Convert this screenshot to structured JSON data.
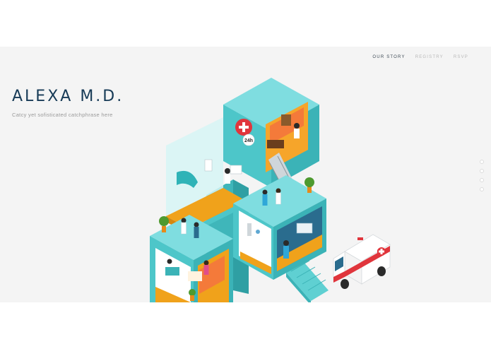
{
  "nav": {
    "items": [
      {
        "label": "OUR STORY",
        "active": true
      },
      {
        "label": "REGISTRY",
        "active": false
      },
      {
        "label": "RSVP",
        "active": false
      }
    ]
  },
  "hero": {
    "title": "ALEXA M.D.",
    "tagline": "Catcy yet sofisticated catchphrase here"
  },
  "illustration": {
    "badge_text": "24h"
  },
  "colors": {
    "background": "#f4f4f4",
    "title": "#163a56",
    "teal": "#4dc6c9",
    "orange": "#f49a1a",
    "red": "#e0353c"
  },
  "icons": [
    "medical-cross-icon",
    "ambulance-icon"
  ]
}
